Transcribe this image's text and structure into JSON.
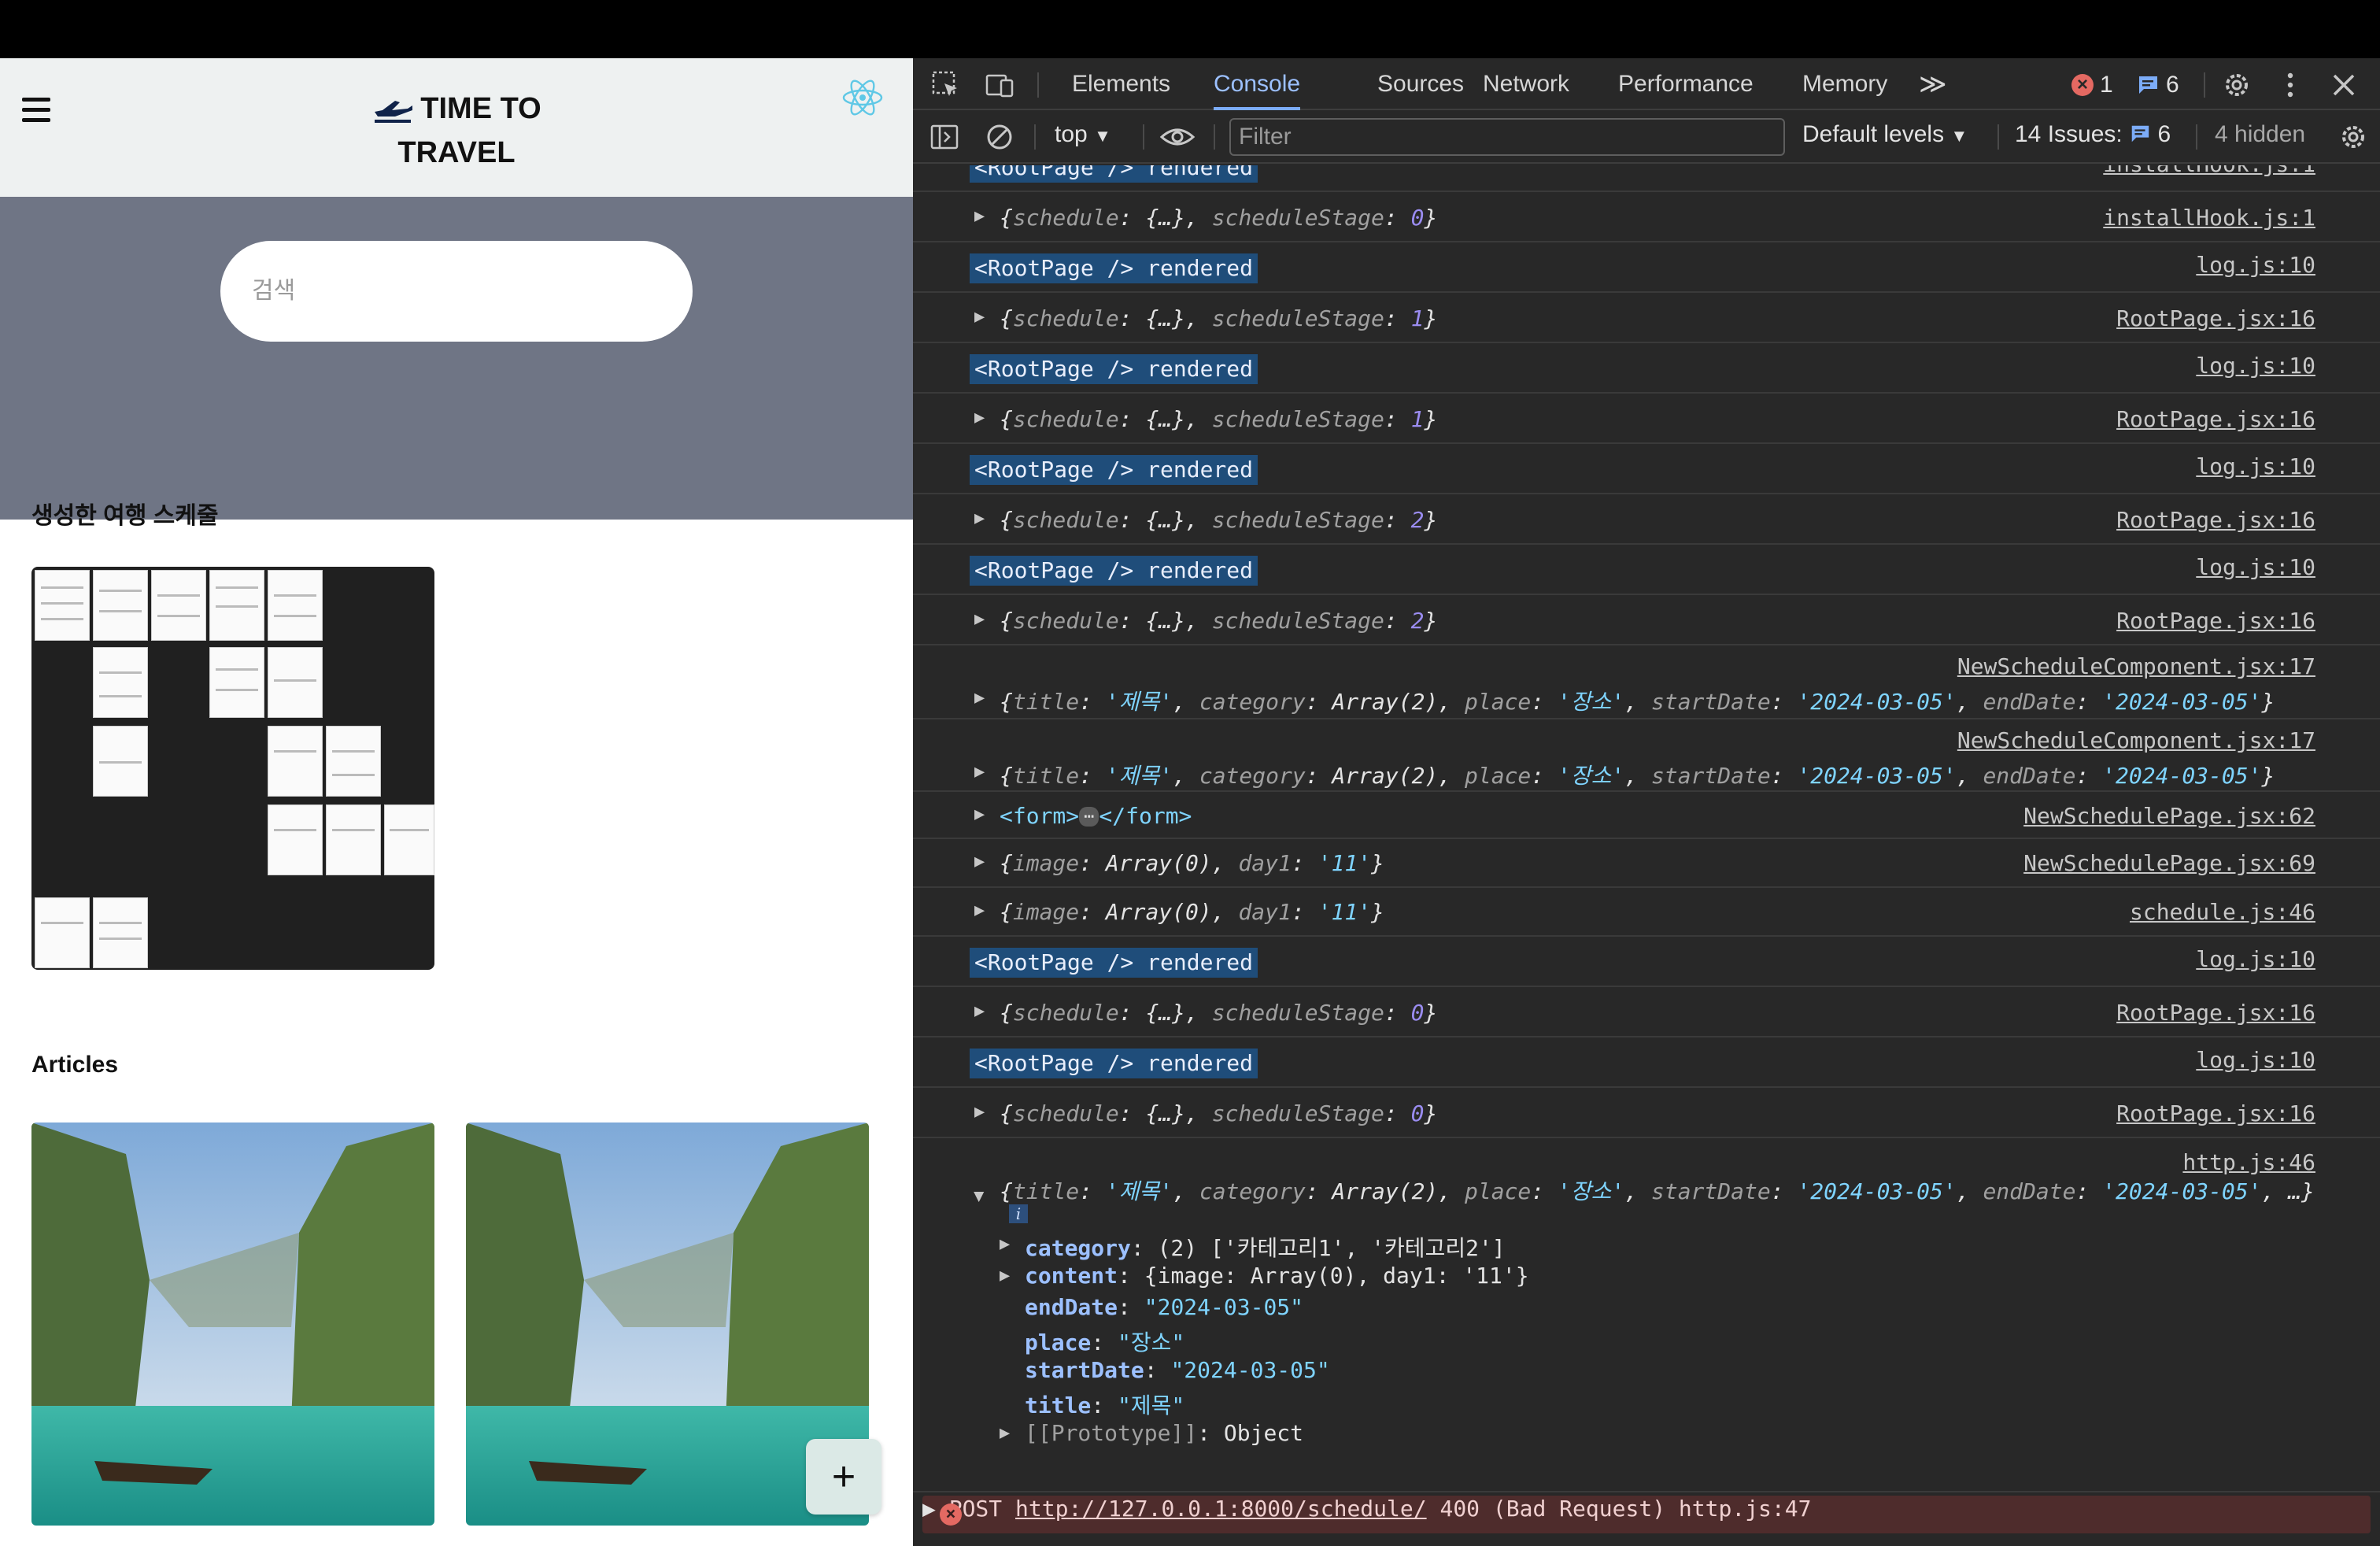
{
  "app": {
    "brand_line1": "TIME TO",
    "brand_line2": "TRAVEL",
    "search_placeholder": "검색",
    "schedules_title": "생성한 여행 스케줄",
    "articles_title": "Articles",
    "fab_label": "+"
  },
  "devtools": {
    "tabs": [
      "Elements",
      "Console",
      "Sources",
      "Network",
      "Performance",
      "Memory"
    ],
    "active_tab": "Console",
    "more_tabs": "≫",
    "error_count": "1",
    "message_count": "6",
    "context": "top",
    "filter_placeholder": "Filter",
    "levels": "Default levels",
    "issues_label": "14 Issues:",
    "issues_count": "6",
    "hidden_label": "4 hidden",
    "accent_color": "#7cacf8",
    "error_color": "#e46962"
  },
  "console": {
    "rendered_text": "<RootPage /> rendered",
    "logs": [
      {
        "kind": "badge",
        "text": "<RootPage /> rendered",
        "source": "installHook.js:1"
      },
      {
        "kind": "obj",
        "key1": "schedule",
        "val1": "{…}",
        "key2": "scheduleStage",
        "val2": "0",
        "source": "installHook.js:1"
      },
      {
        "kind": "badge",
        "text": "<RootPage /> rendered",
        "source": "log.js:10"
      },
      {
        "kind": "obj",
        "key1": "schedule",
        "val1": "{…}",
        "key2": "scheduleStage",
        "val2": "1",
        "source": "RootPage.jsx:16"
      },
      {
        "kind": "badge",
        "text": "<RootPage /> rendered",
        "source": "log.js:10"
      },
      {
        "kind": "obj",
        "key1": "schedule",
        "val1": "{…}",
        "key2": "scheduleStage",
        "val2": "1",
        "source": "RootPage.jsx:16"
      },
      {
        "kind": "badge",
        "text": "<RootPage /> rendered",
        "source": "log.js:10"
      },
      {
        "kind": "obj",
        "key1": "schedule",
        "val1": "{…}",
        "key2": "scheduleStage",
        "val2": "2",
        "source": "RootPage.jsx:16"
      },
      {
        "kind": "badge",
        "text": "<RootPage /> rendered",
        "source": "log.js:10"
      },
      {
        "kind": "obj",
        "key1": "schedule",
        "val1": "{…}",
        "key2": "scheduleStage",
        "val2": "2",
        "source": "RootPage.jsx:16"
      }
    ],
    "new_schedule_logs": [
      {
        "source": "NewScheduleComponent.jsx:17",
        "title": "'제목'",
        "category": "Array(2)",
        "place": "'장소'",
        "startDate": "'2024-03-05'",
        "endDate": "'2024-03-05'"
      },
      {
        "source": "NewScheduleComponent.jsx:17",
        "title": "'제목'",
        "category": "Array(2)",
        "place": "'장소'",
        "startDate": "'2024-03-05'",
        "endDate": "'2024-03-05'"
      }
    ],
    "form_log": {
      "text": "<form>",
      "ellipsis": "⋯",
      "close": "</form>",
      "source": "NewSchedulePage.jsx:62"
    },
    "image_logs": [
      {
        "image": "Array(0)",
        "day1": "'11'",
        "source": "NewSchedulePage.jsx:69"
      },
      {
        "image": "Array(0)",
        "day1": "'11'",
        "source": "schedule.js:46"
      }
    ],
    "later_logs": [
      {
        "kind": "badge",
        "text": "<RootPage /> rendered",
        "source": "log.js:10"
      },
      {
        "kind": "obj",
        "key1": "schedule",
        "val1": "{…}",
        "key2": "scheduleStage",
        "val2": "0",
        "source": "RootPage.jsx:16"
      },
      {
        "kind": "badge",
        "text": "<RootPage /> rendered",
        "source": "log.js:10"
      },
      {
        "kind": "obj",
        "key1": "schedule",
        "val1": "{…}",
        "key2": "scheduleStage",
        "val2": "0",
        "source": "RootPage.jsx:16"
      }
    ],
    "expanded": {
      "source": "http.js:46",
      "summary": {
        "title": "'제목'",
        "category": "Array(2)",
        "place": "'장소'",
        "startDate": "'2024-03-05'",
        "endDate": "'2024-03-05'",
        "more": "…"
      },
      "category_line": "(2) ['카테고리1', '카테고리2']",
      "content_line": "{image: Array(0), day1: '11'}",
      "endDate": "\"2024-03-05\"",
      "place": "\"장소\"",
      "startDate": "\"2024-03-05\"",
      "title": "\"제목\"",
      "prototype": "Object"
    },
    "error": {
      "method": "POST",
      "url": "http://127.0.0.1:8000/schedule/",
      "status": "400 (Bad Request)",
      "source": "http.js:47"
    }
  }
}
